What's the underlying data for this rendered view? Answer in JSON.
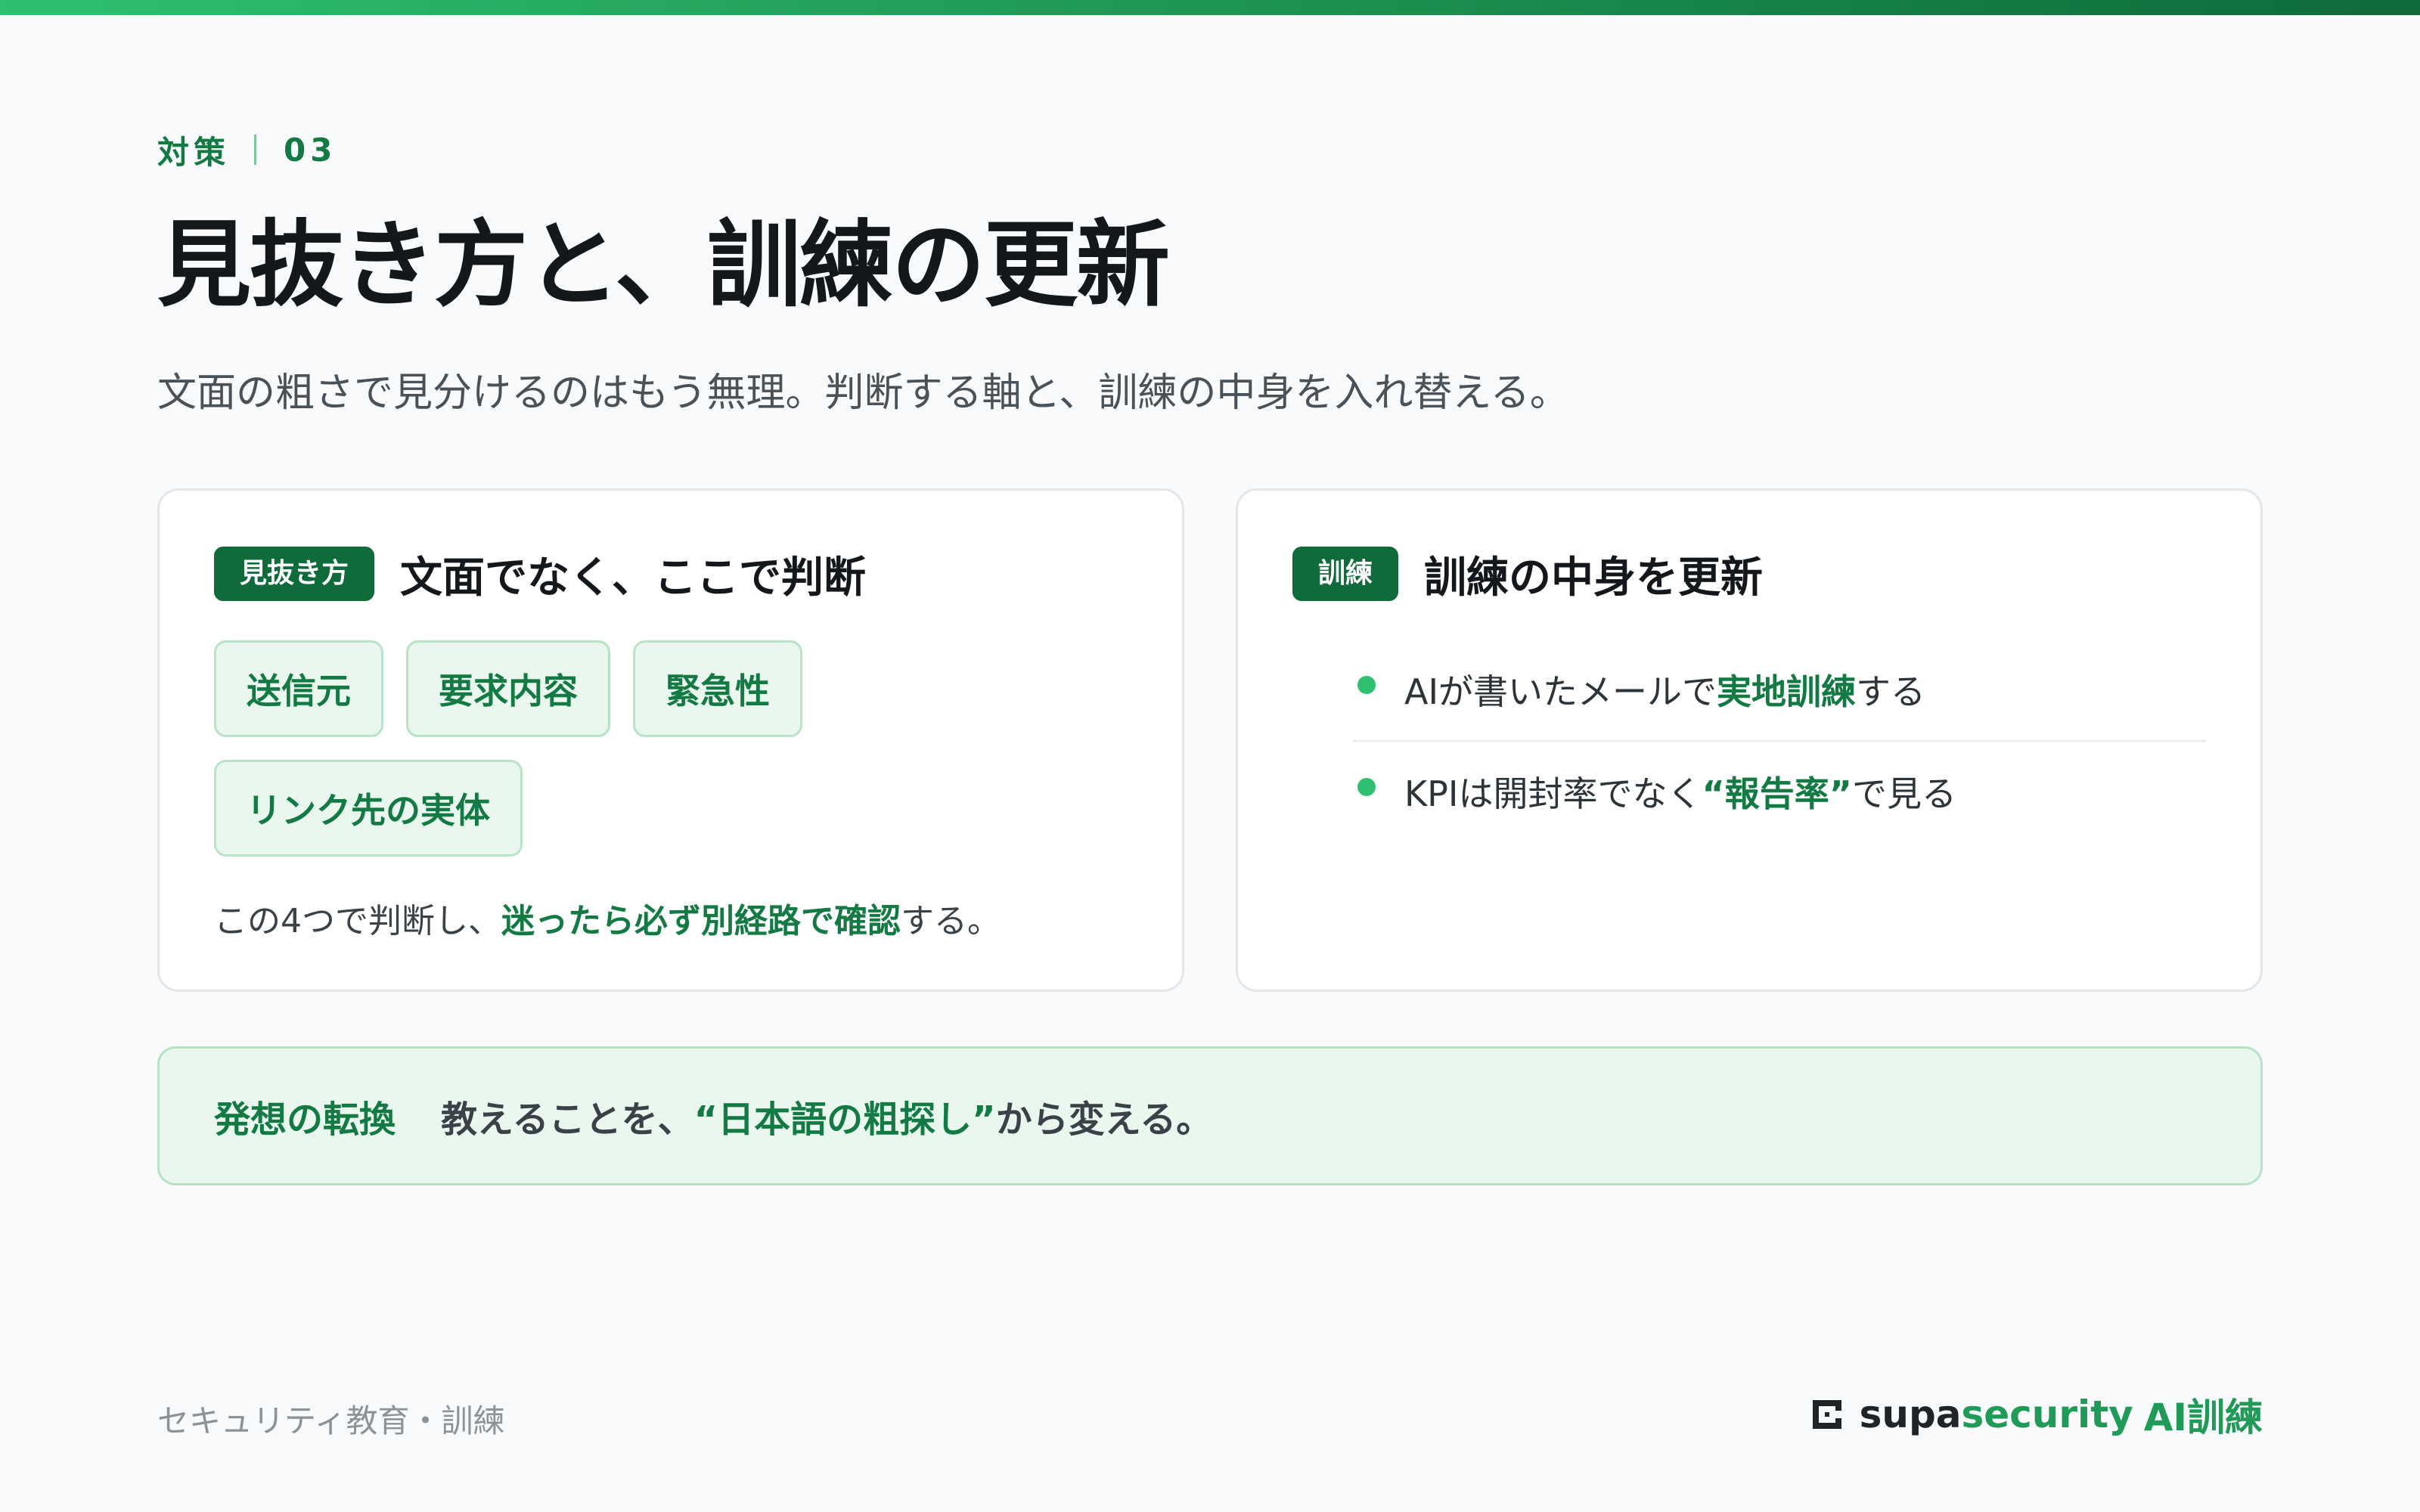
{
  "colors": {
    "accent": "#137a44",
    "accent_dark": "#0f6b3a",
    "accent_bright": "#2fbf71",
    "chip_bg": "#e9f7ee",
    "text": "#14181c",
    "muted": "#8b9298"
  },
  "eyebrow": {
    "label": "対策",
    "number": "03"
  },
  "title": "見抜き方と、訓練の更新",
  "subtitle": "文面の粗さで見分けるのはもう無理。判断する軸と、訓練の中身を入れ替える。",
  "detect_card": {
    "tag": "見抜き方",
    "title": "文面でなく、ここで判断",
    "chips": [
      "送信元",
      "要求内容",
      "緊急性",
      "リンク先の実体"
    ],
    "note": {
      "before": "この4つで判断し、",
      "highlight": "迷ったら必ず別経路で確認",
      "after": "する。"
    }
  },
  "training_card": {
    "tag": "訓練",
    "title": "訓練の中身を更新",
    "bullet_icon": "green-dot",
    "bullets": [
      {
        "before": "AIが書いたメールで",
        "highlight": "実地訓練",
        "after": "する"
      },
      {
        "before": "KPIは開封率でなく",
        "highlight": "“報告率”",
        "after": "で見る"
      }
    ]
  },
  "banner": {
    "label": "発想の転換",
    "before": "教えることを、",
    "highlight": "“日本語の粗探し”",
    "after": "から変える。"
  },
  "footer": {
    "left": "セキュリティ教育・訓練",
    "brand_icon": "supasecurity-logo-mark",
    "brand_main": "supa",
    "brand_accent": "security",
    "brand_product": "AI訓練"
  }
}
